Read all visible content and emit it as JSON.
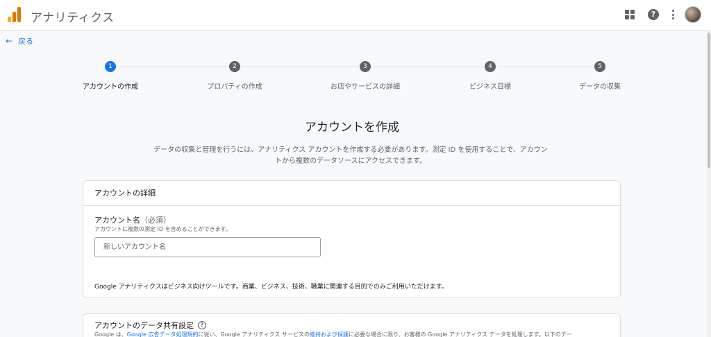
{
  "header": {
    "app_title": "アナリティクス",
    "logo_colors": [
      "#F9AB00",
      "#E37400",
      "#E37400"
    ],
    "icons": [
      "apps-grid-icon",
      "help-icon",
      "more-vert-icon",
      "avatar"
    ]
  },
  "nav": {
    "back_label": "戻る"
  },
  "stepper": {
    "steps": [
      {
        "number": "1",
        "label": "アカウントの作成",
        "active": true
      },
      {
        "number": "2",
        "label": "プロパティの作成",
        "active": false
      },
      {
        "number": "3",
        "label": "お店やサービスの詳細",
        "active": false
      },
      {
        "number": "4",
        "label": "ビジネス目標",
        "active": false
      },
      {
        "number": "5",
        "label": "データの収集",
        "active": false
      }
    ]
  },
  "main": {
    "heading": "アカウントを作成",
    "description": "データの収集と管理を行うには、アナリティクス アカウントを作成する必要があります。測定 ID を使用することで、アカウントから複数のデータソースにアクセスできます。"
  },
  "account_details": {
    "title": "アカウントの詳細",
    "field_label": "アカウント名",
    "field_required": "（必須）",
    "field_hint": "アカウントに複数の測定 ID を含めることができます。",
    "input_placeholder": "新しいアカウント名",
    "input_value": "",
    "notice": "Google アナリティクスはビジネス向けツールです。商業、ビジネス、技術、職業に関連する目的でのみご利用いただけます。"
  },
  "data_sharing": {
    "title": "アカウントのデータ共有設定",
    "body_prefix": "Google は、",
    "link1": "Google 広告データ処理規約",
    "body_middle": "に従い、Google アナリティクス サービスの",
    "link2": "維持および保護",
    "body_suffix": "に必要な場合に限り、お客様の Google アナリティクス データを処理します。以下のデー"
  },
  "colors": {
    "accent": "#1a73e8",
    "step_inactive": "#5f6368"
  }
}
